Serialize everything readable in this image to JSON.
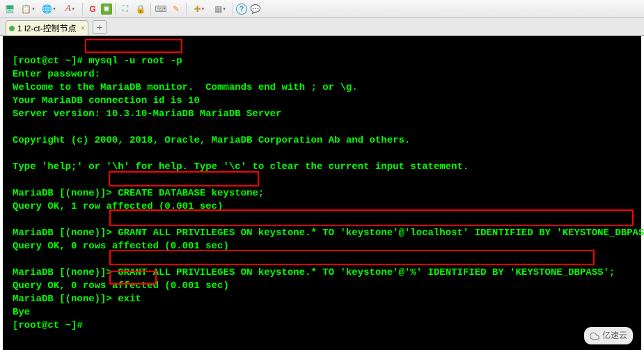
{
  "toolbar": {
    "items": [
      {
        "name": "connect-icon",
        "glyph": "🖥",
        "color": "#3a7"
      },
      {
        "name": "copy-icon",
        "glyph": "📋",
        "color": "#6a8"
      },
      {
        "name": "globe-icon",
        "glyph": "🌐",
        "color": "#3a7",
        "dropdown": true
      },
      {
        "name": "font-icon",
        "glyph": "A",
        "color": "#c55",
        "italic": true,
        "dropdown": true
      },
      {
        "sep": true
      },
      {
        "name": "refresh-icon",
        "glyph": "⟳",
        "color": "#d33"
      },
      {
        "name": "script-icon",
        "glyph": "▣",
        "color": "#6a3"
      },
      {
        "sep": true
      },
      {
        "name": "expand-icon",
        "glyph": "⛶",
        "color": "#3a7"
      },
      {
        "name": "lock-icon",
        "glyph": "🔒",
        "color": "#c93"
      },
      {
        "sep": true
      },
      {
        "name": "keyboard-icon",
        "glyph": "⌨",
        "color": "#888"
      },
      {
        "name": "edit-icon",
        "glyph": "✎",
        "color": "#c93"
      },
      {
        "sep": true
      },
      {
        "name": "add-icon",
        "glyph": "➕",
        "color": "#c93",
        "dropdown": true
      },
      {
        "name": "grid-icon",
        "glyph": "▦",
        "color": "#888",
        "dropdown": true
      },
      {
        "sep": true
      },
      {
        "name": "help-icon",
        "glyph": "?",
        "color": "#39c",
        "circle": true
      },
      {
        "name": "chat-icon",
        "glyph": "💬",
        "color": "#39c"
      }
    ]
  },
  "tabs": {
    "items": [
      {
        "label": "1 l2-ct-控制节点",
        "indicator": "#4caf50"
      }
    ],
    "add": "+"
  },
  "terminal": {
    "lines": [
      {
        "prompt": "[root@ct ~]# ",
        "cmd": "mysql -u root -p"
      },
      {
        "text": "Enter password:"
      },
      {
        "text": "Welcome to the MariaDB monitor.  Commands end with ; or \\g."
      },
      {
        "text": "Your MariaDB connection id is 10"
      },
      {
        "text": "Server version: 10.3.10-MariaDB MariaDB Server"
      },
      {
        "text": ""
      },
      {
        "text": "Copyright (c) 2000, 2018, Oracle, MariaDB Corporation Ab and others."
      },
      {
        "text": ""
      },
      {
        "text": "Type 'help;' or '\\h' for help. Type '\\c' to clear the current input statement."
      },
      {
        "text": ""
      },
      {
        "prompt": "MariaDB [(none)]> ",
        "cmd": "CREATE DATABASE keystone;"
      },
      {
        "text": "Query OK, 1 row affected (0.001 sec)"
      },
      {
        "text": ""
      },
      {
        "prompt": "MariaDB [(none)]> ",
        "cmd": "GRANT ALL PRIVILEGES ON keystone.* TO 'keystone'@'localhost' IDENTIFIED BY 'KEYSTONE_DBPASS';"
      },
      {
        "text": "Query OK, 0 rows affected (0.001 sec)"
      },
      {
        "text": ""
      },
      {
        "prompt": "MariaDB [(none)]> ",
        "cmd": "GRANT ALL PRIVILEGES ON keystone.* TO 'keystone'@'%' IDENTIFIED BY 'KEYSTONE_DBPASS';"
      },
      {
        "text": "Query OK, 0 rows affected (0.001 sec)"
      },
      {
        "prompt": "MariaDB [(none)]> ",
        "cmd": "exit"
      },
      {
        "text": "Bye"
      },
      {
        "prompt": "[root@ct ~]# ",
        "cmd": ""
      }
    ]
  },
  "watermark": {
    "text": "亿速云"
  }
}
